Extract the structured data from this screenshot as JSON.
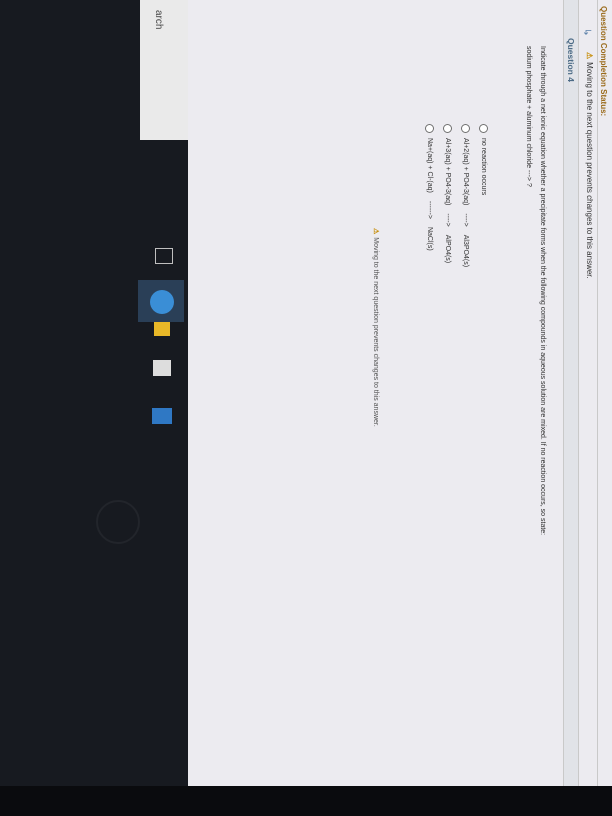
{
  "page": {
    "completion_status": "Question Completion Status:",
    "nav_warning": "Moving to the next question prevents changes to this answer.",
    "question_title": "Question 4",
    "prompt_line1": "Indicate through a net ionic equation whether a precipitate forms when the following compounds in aqueous solution are mixed. If no reaction occurs, so state:",
    "prompt_line2": "sodium phosphate + aluminum chloride ---> ?",
    "options": [
      {
        "text": "no reaction occurs"
      },
      {
        "left": "Al+2(aq) + PO4-3(aq)",
        "arrow": "---->",
        "right": "Al3PO4(s)"
      },
      {
        "left": "Al+3(aq) + PO4-3(aq)",
        "arrow": "---->",
        "right": "AlPO4(s)"
      },
      {
        "left": "Na+(aq) + Cl-(aq)",
        "arrow": "------>",
        "right": "NaCl(s)"
      }
    ],
    "bottom_warning": "Moving to the next question prevents changes to this answer."
  },
  "taskbar": {
    "search_label": "arch",
    "icons": [
      "task-view-icon",
      "edge-icon",
      "file-explorer-icon",
      "store-icon",
      "mail-icon"
    ]
  },
  "colors": {
    "accent": "#4c6b86",
    "warning": "#c58a00",
    "taskbar": "#171a20"
  }
}
